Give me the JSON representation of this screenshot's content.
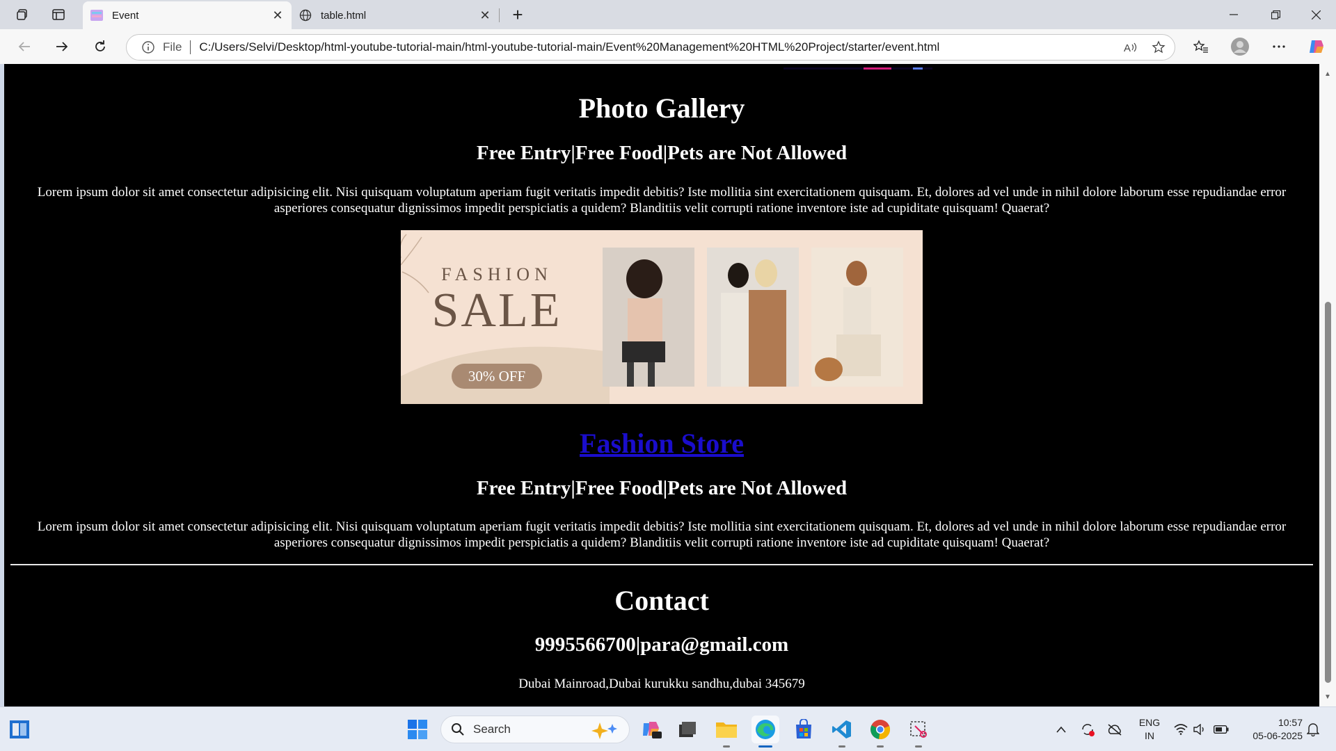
{
  "browser": {
    "tabs": [
      {
        "title": "Event",
        "active": true
      },
      {
        "title": "table.html",
        "active": false
      }
    ],
    "address": {
      "scheme_label": "File",
      "url": "C:/Users/Selvi/Desktop/html-youtube-tutorial-main/html-youtube-tutorial-main/Event%20Management%20HTML%20Project/starter/event.html"
    }
  },
  "page": {
    "gallery_heading": "Photo Gallery",
    "info_line_1": "Free Entry|Free Food|Pets are Not Allowed",
    "paragraph_1": "Lorem ipsum dolor sit amet consectetur adipisicing elit. Nisi quisquam voluptatum aperiam fugit veritatis impedit debitis? Iste mollitia sint exercitationem quisquam. Et, dolores ad vel unde in nihil dolore laborum esse repudiandae error asperiores consequatur dignissimos impedit perspiciatis a quidem? Blanditiis velit corrupti ratione inventore iste ad cupiditate quisquam! Quaerat?",
    "banner": {
      "line1": "FASHION",
      "line2": "SALE",
      "badge": "30% OFF"
    },
    "store_link": "Fashion Store",
    "info_line_2": "Free Entry|Free Food|Pets are Not Allowed",
    "paragraph_2": "Lorem ipsum dolor sit amet consectetur adipisicing elit. Nisi quisquam voluptatum aperiam fugit veritatis impedit debitis? Iste mollitia sint exercitationem quisquam. Et, dolores ad vel unde in nihil dolore laborum esse repudiandae error asperiores consequatur dignissimos impedit perspiciatis a quidem? Blanditiis velit corrupti ratione inventore iste ad cupiditate quisquam! Quaerat?",
    "contact_heading": "Contact",
    "contact_line": "9995566700|para@gmail.com",
    "address_line": "Dubai Mainroad,Dubai kurukku sandhu,dubai 345679"
  },
  "taskbar": {
    "search_label": "Search",
    "lang_line1": "ENG",
    "lang_line2": "IN",
    "time": "10:57",
    "date": "05-06-2025"
  },
  "colors": {
    "page_bg": "#000000",
    "link": "#1a0dcc",
    "banner_bg": "#f5e1d2",
    "banner_text": "#6b5546",
    "badge_bg": "#a98a72"
  }
}
